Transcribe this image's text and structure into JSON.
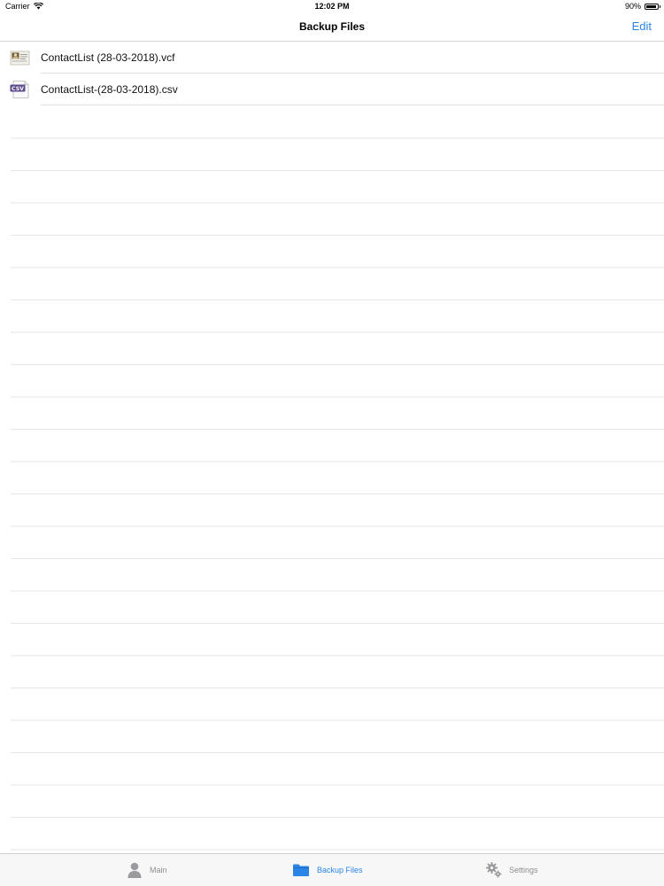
{
  "status_bar": {
    "carrier": "Carrier",
    "time": "12:02 PM",
    "battery": "90%",
    "battery_level": 0.9
  },
  "nav": {
    "title": "Backup Files",
    "edit_label": "Edit"
  },
  "files": [
    {
      "name": "ContactList (28-03-2018).vcf",
      "icon": "vcf-file-icon"
    },
    {
      "name": "ContactList-(28-03-2018).csv",
      "icon": "csv-file-icon",
      "icon_text": "CSV"
    }
  ],
  "tabs": [
    {
      "label": "Main",
      "icon": "person-icon",
      "active": false
    },
    {
      "label": "Backup Files",
      "icon": "folder-icon",
      "active": true
    },
    {
      "label": "Settings",
      "icon": "gears-icon",
      "active": false
    }
  ],
  "colors": {
    "accent": "#2a85e6",
    "inactive_tab": "#8e8e93",
    "csv_icon": "#5a4a8a"
  }
}
